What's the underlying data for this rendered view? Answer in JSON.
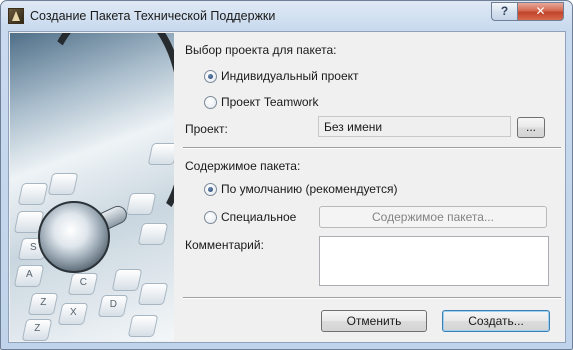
{
  "window": {
    "title": "Создание Пакета Технической Поддержки",
    "help_button": "?",
    "close_button": "✕"
  },
  "project_section": {
    "heading": "Выбор проекта для пакета:",
    "options": [
      {
        "label": "Индивидуальный проект",
        "selected": true
      },
      {
        "label": "Проект Teamwork",
        "selected": false
      }
    ],
    "project_label": "Проект:",
    "project_value": "Без имени",
    "browse_button": "..."
  },
  "content_section": {
    "heading": "Содержимое пакета:",
    "options": [
      {
        "label": "По умолчанию (рекомендуется)",
        "selected": true
      },
      {
        "label": "Специальное",
        "selected": false
      }
    ],
    "contents_button": "Содержимое пакета...",
    "comment_label": "Комментарий:",
    "comment_value": ""
  },
  "footer": {
    "cancel_button": "Отменить",
    "create_button": "Создать..."
  },
  "hero": {
    "description_icon": "stethoscope-on-keyboard-image",
    "key_glyphs": [
      "S",
      "C",
      "A",
      "Z",
      "X",
      "D",
      "Z"
    ]
  },
  "colors": {
    "title_bar": "#c9daee",
    "close_button": "#c0432a",
    "default_button_border": "#3c7fb1"
  }
}
